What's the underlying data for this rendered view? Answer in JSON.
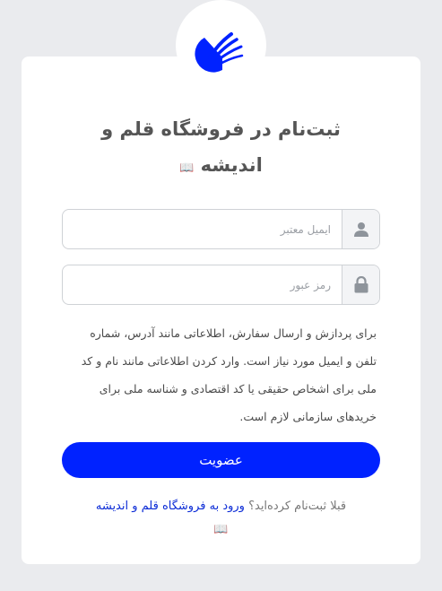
{
  "brand": {
    "logo": "quill-logo-icon",
    "primary_color": "#0022ff"
  },
  "title": {
    "line1": "ثبت‌نام در فروشگاه قلم و",
    "line2": "اندیشه",
    "emoji": "📖"
  },
  "email_field": {
    "placeholder": "ایمیل معتبر",
    "icon": "user-icon"
  },
  "password_field": {
    "placeholder": "رمز عبور",
    "icon": "lock-icon"
  },
  "info_text": "برای پردازش و ارسال سفارش، اطلاعاتی مانند آدرس، شماره تلفن و ایمیل مورد نیاز است. وارد کردن اطلاعاتی مانند نام و کد ملی برای اشخاص حقیقی یا کد اقتصادی و شناسه ملی برای خریدهای سازمانی لازم است.",
  "submit_label": "عضویت",
  "login": {
    "prompt": "قبلا ثبت‌نام کرده‌اید؟",
    "link_label": "ورود به فروشگاه قلم و اندیشه",
    "emoji": "📖"
  }
}
